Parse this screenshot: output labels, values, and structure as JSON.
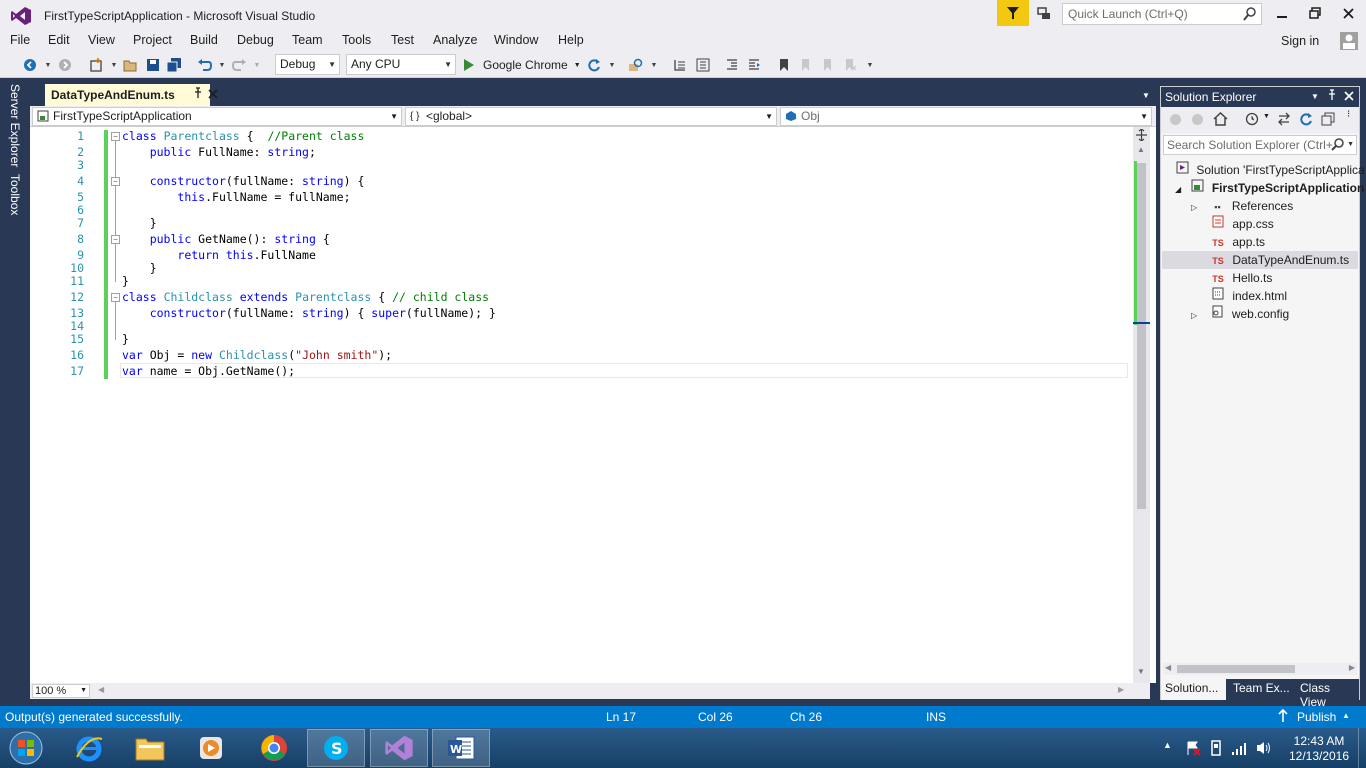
{
  "window": {
    "title": "FirstTypeScriptApplication - Microsoft Visual Studio",
    "quick_launch_placeholder": "Quick Launch (Ctrl+Q)"
  },
  "menu": {
    "items": [
      "File",
      "Edit",
      "View",
      "Project",
      "Build",
      "Debug",
      "Team",
      "Tools",
      "Test",
      "Analyze",
      "Window",
      "Help"
    ],
    "sign_in": "Sign in"
  },
  "toolbar": {
    "configuration": "Debug",
    "platform": "Any CPU",
    "run_target": "Google Chrome"
  },
  "side_tabs": [
    "Server Explorer",
    "Toolbox"
  ],
  "document_tab": {
    "name": "DataTypeAndEnum.ts"
  },
  "nav": {
    "project": "FirstTypeScriptApplication",
    "scope": "<global>",
    "member": "Obj"
  },
  "editor": {
    "line_numbers": [
      "1",
      "2",
      "3",
      "4",
      "5",
      "6",
      "7",
      "8",
      "9",
      "10",
      "11",
      "12",
      "13",
      "14",
      "15",
      "16",
      "17"
    ],
    "zoom": "100 %"
  },
  "solution_explorer": {
    "title": "Solution Explorer",
    "search_placeholder": "Search Solution Explorer (Ctrl+",
    "solution": "Solution 'FirstTypeScriptApplica",
    "project": "FirstTypeScriptApplication",
    "items": [
      "References",
      "app.css",
      "app.ts",
      "DataTypeAndEnum.ts",
      "Hello.ts",
      "index.html",
      "web.config"
    ],
    "tabs": [
      "Solution...",
      "Team Ex...",
      "Class View"
    ]
  },
  "status": {
    "message": "Output(s) generated successfully.",
    "ln": "Ln 17",
    "col": "Col 26",
    "ch": "Ch 26",
    "mode": "INS",
    "publish": "Publish"
  },
  "clock": {
    "time": "12:43 AM",
    "date": "12/13/2016"
  },
  "colors": {
    "accent": "#007acc",
    "titlebar": "#eeeef2",
    "frame": "#293955",
    "keyword": "#0000ff",
    "type": "#2b91af",
    "comment": "#008000",
    "string": "#a31515"
  }
}
